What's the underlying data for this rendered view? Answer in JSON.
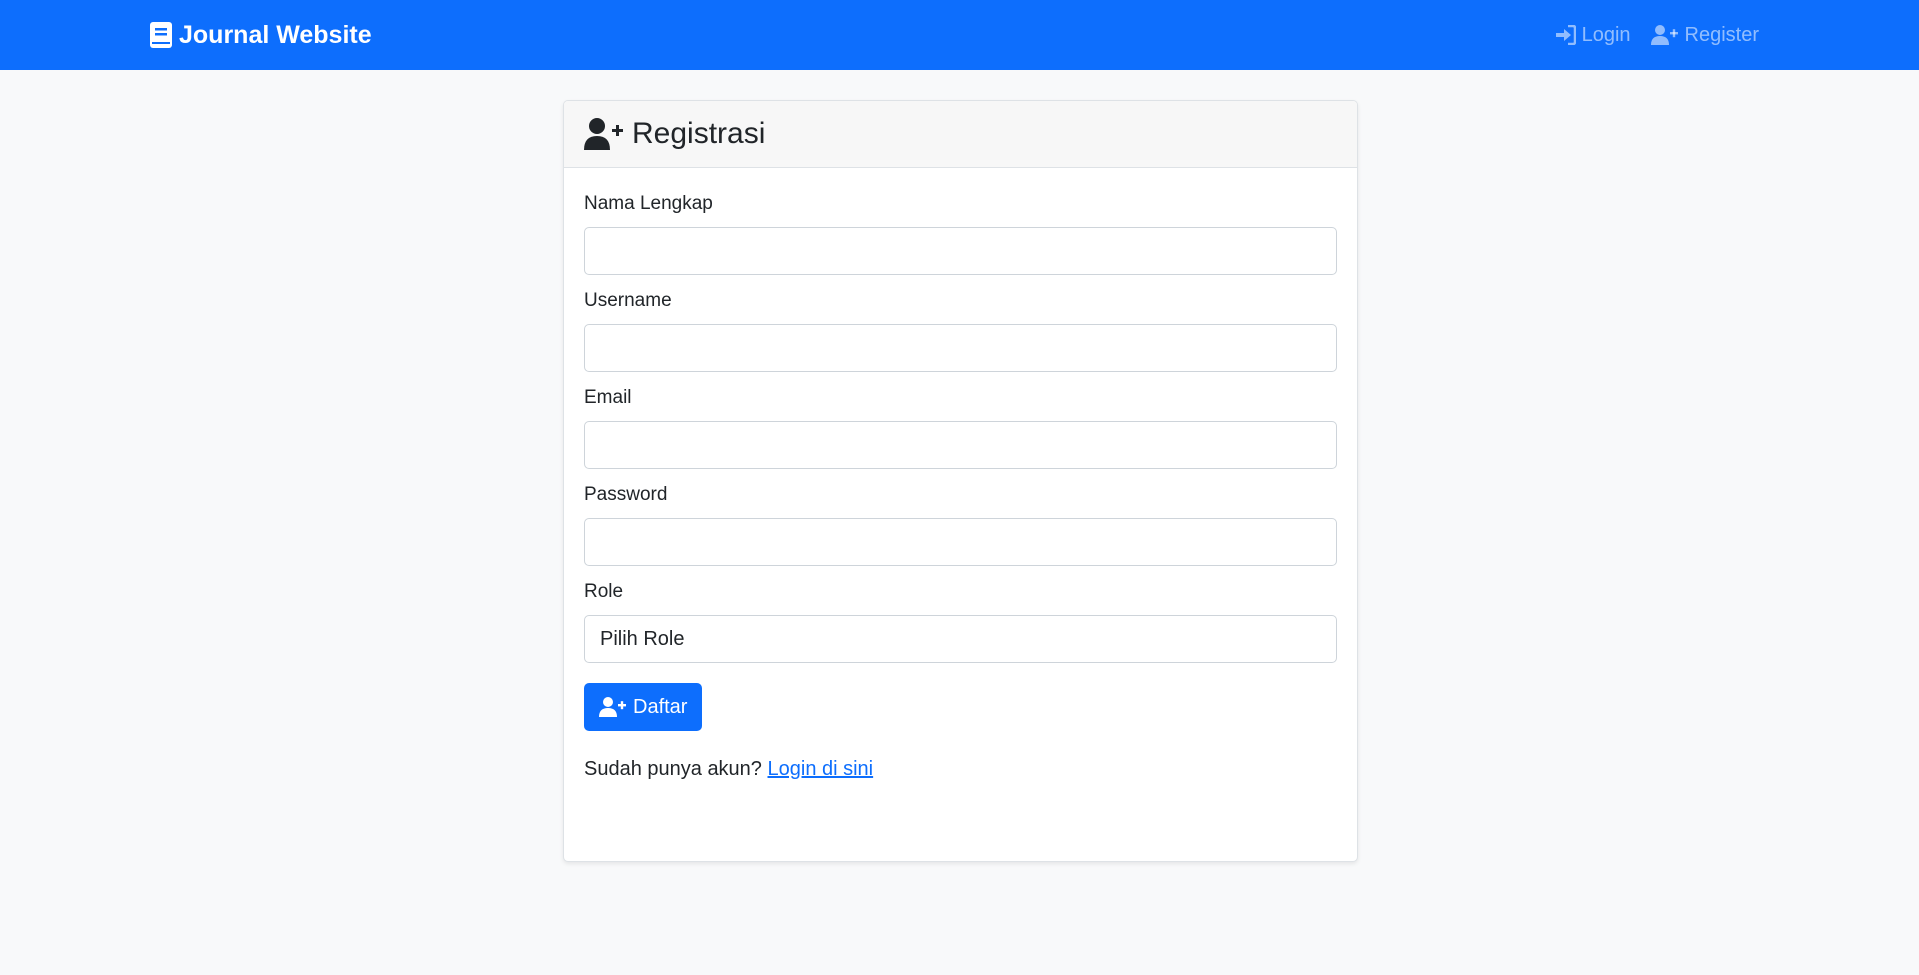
{
  "navbar": {
    "brand": "Journal Website",
    "links": [
      {
        "label": "Login",
        "icon": "sign-in-icon"
      },
      {
        "label": "Register",
        "icon": "user-plus-icon"
      }
    ]
  },
  "card": {
    "title": "Registrasi",
    "fields": [
      {
        "label": "Nama Lengkap",
        "value": "",
        "placeholder": ""
      },
      {
        "label": "Username",
        "value": "",
        "placeholder": ""
      },
      {
        "label": "Email",
        "value": "",
        "placeholder": ""
      },
      {
        "label": "Password",
        "value": "",
        "placeholder": ""
      }
    ],
    "role": {
      "label": "Role",
      "selected": "Pilih Role"
    },
    "submit_label": "Daftar",
    "footer": {
      "text": "Sudah punya akun?",
      "link": "Login di sini"
    }
  },
  "colors": {
    "primary": "#0d6efd",
    "background": "#f8f9fa",
    "card_header": "#f7f7f7"
  }
}
